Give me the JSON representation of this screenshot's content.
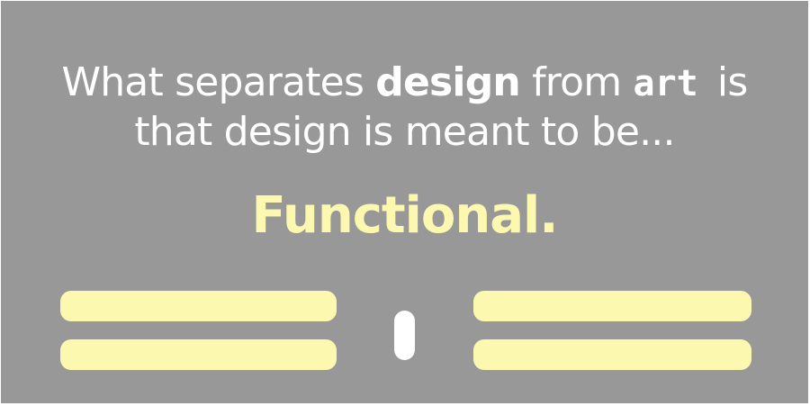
{
  "headline": {
    "part1": "What separates ",
    "word_design": "design",
    "part2": " from ",
    "word_art": "art",
    "part3": " is",
    "line2": "that design is meant to be..."
  },
  "emphasis": {
    "text": "Functional."
  },
  "colors": {
    "background": "#989898",
    "text": "#ffffff",
    "accent": "#fdf8b0"
  }
}
